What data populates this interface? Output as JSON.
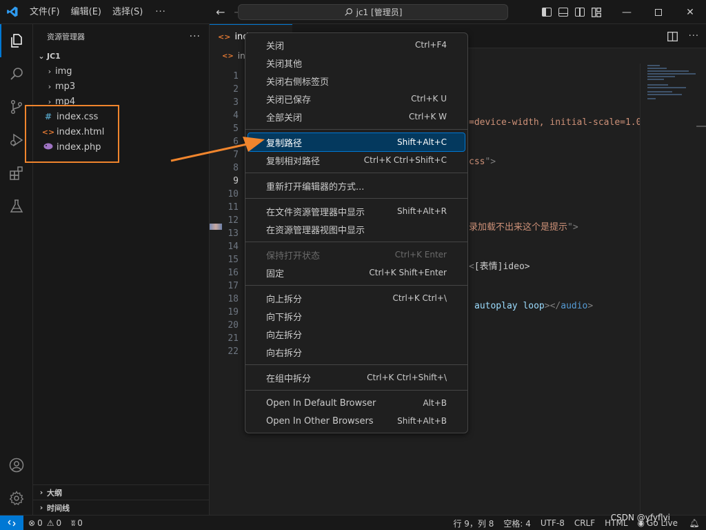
{
  "titlebar": {
    "menus": [
      "文件(F)",
      "编辑(E)",
      "选择(S)"
    ],
    "more": "···",
    "search": "jc1 [管理员]"
  },
  "sidebar": {
    "title": "资源管理器",
    "more": "···",
    "root": "JC1",
    "folders": [
      "img",
      "mp3",
      "mp4"
    ],
    "files": [
      {
        "name": "index.css",
        "icon": "#",
        "color": "#519aba"
      },
      {
        "name": "index.html",
        "icon": "<>",
        "color": "#e37933"
      },
      {
        "name": "index.php",
        "icon": "php",
        "color": "#a074c4"
      }
    ],
    "outline": "大纲",
    "timeline": "时间线"
  },
  "editor": {
    "tab_label": "ind",
    "breadcrumb": "ind",
    "line_numbers": [
      "1",
      "2",
      "3",
      "4",
      "5",
      "6",
      "7",
      "8",
      "9",
      "10",
      "11",
      "12",
      "13",
      "14",
      "15",
      "16",
      "17",
      "18",
      "19",
      "20",
      "21",
      "22"
    ],
    "current_line": "9",
    "code": {
      "line5_a": "=device-width, initial-scale=1.0",
      "line5_b": "\"",
      "line8_a": "css",
      "line8_b": "\">",
      "line13_a": "录加载不出来这个是提示",
      "line13_b": "\">",
      "line16_a": "<",
      "line16_b": "[表情]ideo>",
      "line19_a": "autoplay",
      "line19_b": "loop",
      "line19_c": "></",
      "line19_d": "audio",
      "line19_e": ">"
    }
  },
  "context_menu": {
    "groups": [
      [
        {
          "label": "关闭",
          "shortcut": "Ctrl+F4"
        },
        {
          "label": "关闭其他",
          "shortcut": ""
        },
        {
          "label": "关闭右侧标签页",
          "shortcut": ""
        },
        {
          "label": "关闭已保存",
          "shortcut": "Ctrl+K U"
        },
        {
          "label": "全部关闭",
          "shortcut": "Ctrl+K W"
        }
      ],
      [
        {
          "label": "复制路径",
          "shortcut": "Shift+Alt+C",
          "highlighted": true
        },
        {
          "label": "复制相对路径",
          "shortcut": "Ctrl+K Ctrl+Shift+C"
        }
      ],
      [
        {
          "label": "重新打开编辑器的方式...",
          "shortcut": ""
        }
      ],
      [
        {
          "label": "在文件资源管理器中显示",
          "shortcut": "Shift+Alt+R"
        },
        {
          "label": "在资源管理器视图中显示",
          "shortcut": ""
        }
      ],
      [
        {
          "label": "保持打开状态",
          "shortcut": "Ctrl+K Enter",
          "disabled": true
        },
        {
          "label": "固定",
          "shortcut": "Ctrl+K Shift+Enter"
        }
      ],
      [
        {
          "label": "向上拆分",
          "shortcut": "Ctrl+K Ctrl+\\"
        },
        {
          "label": "向下拆分",
          "shortcut": ""
        },
        {
          "label": "向左拆分",
          "shortcut": ""
        },
        {
          "label": "向右拆分",
          "shortcut": ""
        }
      ],
      [
        {
          "label": "在组中拆分",
          "shortcut": "Ctrl+K Ctrl+Shift+\\"
        }
      ],
      [
        {
          "label": "Open In Default Browser",
          "shortcut": "Alt+B"
        },
        {
          "label": "Open In Other Browsers",
          "shortcut": "Shift+Alt+B"
        }
      ]
    ]
  },
  "statusbar": {
    "errors": "0",
    "warnings": "0",
    "ports": "0",
    "position": "行 9，列 8",
    "spaces": "空格: 4",
    "encoding": "UTF-8",
    "eol": "CRLF",
    "language": "HTML",
    "golive": "Go Live"
  },
  "watermark": "CSDN @yfyflyi",
  "colors": {
    "accent": "#0078d4",
    "annotation": "#f0852d",
    "menu_highlight": "#04395e"
  }
}
